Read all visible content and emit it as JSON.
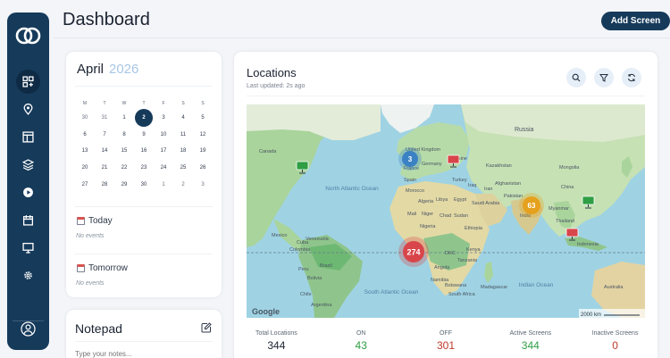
{
  "header": {
    "title": "Dashboard",
    "add_button": "Add Screen"
  },
  "sidebar": {
    "items": [
      {
        "icon": "dashboard-icon",
        "active": true
      },
      {
        "icon": "location-pin-icon",
        "active": false
      },
      {
        "icon": "layout-icon",
        "active": false
      },
      {
        "icon": "stack-icon",
        "active": false
      },
      {
        "icon": "play-icon",
        "active": false
      },
      {
        "icon": "calendar-icon",
        "active": false
      },
      {
        "icon": "monitor-icon",
        "active": false
      },
      {
        "icon": "gear-icon",
        "active": false
      }
    ],
    "bottom": {
      "icon": "user-icon"
    }
  },
  "calendar": {
    "month": "April",
    "year": "2026",
    "weekdays": [
      "M",
      "T",
      "W",
      "T",
      "F",
      "S",
      "S"
    ],
    "weeks": [
      [
        "30",
        "31",
        "1",
        "2",
        "3",
        "4",
        "5"
      ],
      [
        "6",
        "7",
        "8",
        "9",
        "10",
        "11",
        "12"
      ],
      [
        "13",
        "14",
        "15",
        "16",
        "17",
        "18",
        "19"
      ],
      [
        "20",
        "21",
        "22",
        "23",
        "24",
        "25",
        "26"
      ],
      [
        "27",
        "28",
        "29",
        "30",
        "1",
        "2",
        "3"
      ]
    ],
    "today": "2",
    "today_label": "Today",
    "today_empty": "No events",
    "tomorrow_label": "Tomorrow",
    "tomorrow_empty": "No events"
  },
  "notepad": {
    "title": "Notepad",
    "placeholder": "Type your notes..."
  },
  "locations": {
    "title": "Locations",
    "updated": "Last updated: 2s ago",
    "map": {
      "labels": {
        "canada": "Canada",
        "north_atlantic": "North Atlantic Ocean",
        "south_atlantic": "South Atlantic Ocean",
        "indian": "Indian Ocean",
        "russia": "Russia",
        "kazakhstan": "Kazakhstan",
        "china": "China",
        "india": "India",
        "brazil": "Brazil",
        "australia": "Australia",
        "mexico": "Mexico",
        "nigeria": "Nigeria",
        "egypt": "Egypt",
        "algeria": "Algeria",
        "saudi": "Saudi Arabia",
        "iran": "Iran",
        "ethiopia": "Ethiopia",
        "kenya": "Kenya",
        "drc": "DRC",
        "angola": "Angola",
        "namibia": "Namibia",
        "botswana": "Botswana",
        "madagascar": "Madagascar",
        "peru": "Peru",
        "bolivia": "Bolivia",
        "argentina": "Argentina",
        "chile": "Chile",
        "colombia": "Colombia",
        "venezuela": "Venezuela",
        "sudan": "Sudan",
        "chad": "Chad",
        "niger": "Niger",
        "mali": "Mali",
        "libya": "Libya",
        "morocco": "Morocco",
        "spain": "Spain",
        "france": "France",
        "germany": "Germany",
        "ukraine": "Ukraine",
        "turkey": "Turkey",
        "iraq": "Iraq",
        "afghanistan": "Afghanistan",
        "pakistan": "Pakistan",
        "myanmar": "Myanmar",
        "thailand": "Thailand",
        "mongolia": "Mongolia",
        "indonesia": "Indonesia",
        "south_africa": "South Africa",
        "united_kingdom": "United Kingdom",
        "tanzania": "Tanzania",
        "cuba": "Cuba"
      },
      "clusters": [
        {
          "label": "3",
          "color": "#3b82c4"
        },
        {
          "label": "63",
          "color": "#e5a11d"
        },
        {
          "label": "274",
          "color": "#d8454a"
        }
      ],
      "scale": "2000 km",
      "brand": "Google"
    },
    "stats": [
      {
        "label": "Total Locations",
        "value": "344",
        "color": "#1a2230"
      },
      {
        "label": "ON",
        "value": "43",
        "color": "#2f9e44"
      },
      {
        "label": "OFF",
        "value": "301",
        "color": "#c0392b"
      },
      {
        "label": "Active Screens",
        "value": "344",
        "color": "#2f9e44"
      },
      {
        "label": "Inactive Screens",
        "value": "0",
        "color": "#c0392b"
      }
    ]
  }
}
